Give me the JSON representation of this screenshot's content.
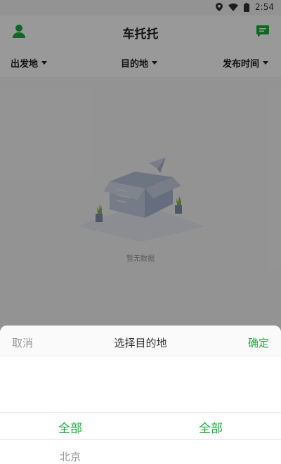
{
  "status_bar": {
    "time": "2:54",
    "icons": [
      "location-icon",
      "wifi-icon",
      "battery-icon"
    ]
  },
  "header": {
    "title": "车托托",
    "left_icon": "user-icon",
    "right_icon": "message-icon",
    "accent_color": "#1aad3b"
  },
  "filters": {
    "origin": "出发地",
    "destination": "目的地",
    "publish_time": "发布时间"
  },
  "content": {
    "empty_text": "暂无数据"
  },
  "picker": {
    "cancel": "取消",
    "title": "选择目的地",
    "confirm": "确定",
    "columns": [
      {
        "selected": "全部",
        "next": "北京"
      },
      {
        "selected": "全部",
        "next": ""
      }
    ]
  }
}
